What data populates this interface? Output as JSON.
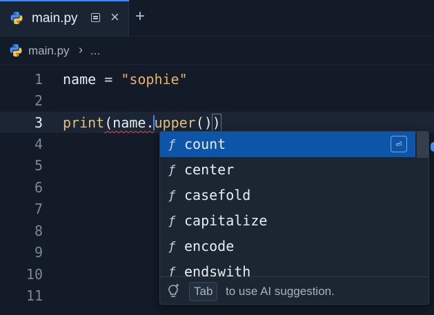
{
  "tab": {
    "title": "main.py"
  },
  "breadcrumb": {
    "file": "main.py",
    "separator": "›",
    "more": "..."
  },
  "editor": {
    "line_numbers": [
      "1",
      "2",
      "3",
      "4",
      "5",
      "6",
      "7",
      "8",
      "9",
      "10",
      "11"
    ],
    "current_line": "3",
    "line1": {
      "var": "name",
      "op": "=",
      "str": "\"sophie\""
    },
    "line3": {
      "fn": "print",
      "open": "(",
      "obj": "name",
      "dot": ".",
      "method": "upper",
      "call_open": "(",
      "call_close": ")",
      "close": ")"
    }
  },
  "suggestions": {
    "kind_symbol": "ƒ",
    "accept_symbol": "⏎",
    "items": [
      "count",
      "center",
      "casefold",
      "capitalize",
      "encode",
      "endswith"
    ],
    "selected": "count"
  },
  "ai_hint": {
    "key": "Tab",
    "text": "to use AI suggestion."
  },
  "colors": {
    "accent": "#3d8bfd",
    "selected": "#0d55a8",
    "string": "#e9b06e",
    "function": "#e5c07b",
    "error": "#e24a4a"
  },
  "icons": {
    "tab_file": "python-icon",
    "breadcrumb_file": "python-icon",
    "ai": "sparkle-lightbulb-icon",
    "preview": "open-preview-icon",
    "close": "close-icon",
    "new_tab": "plus-icon"
  }
}
